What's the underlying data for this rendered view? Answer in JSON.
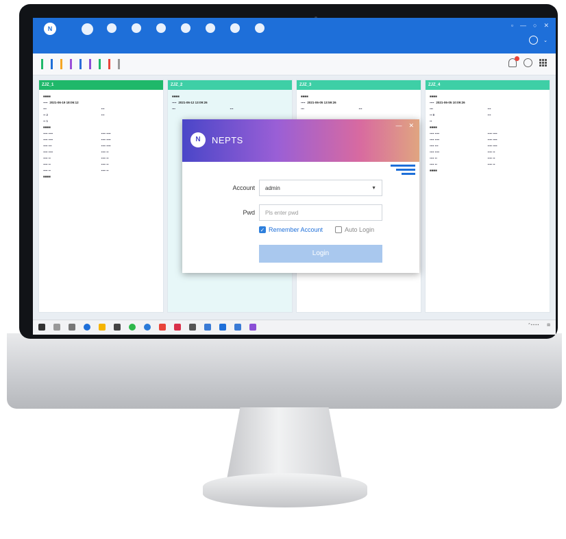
{
  "colors": {
    "header_blue": "#1e6fd9",
    "card_green": "#1fb86a",
    "card_teal": "#3ecfa6",
    "login_button": "#a9c8ee",
    "checkbox_on": "#2e7fdc"
  },
  "app": {
    "logo_mark": "N",
    "logo_text": "",
    "nav": [
      {
        "label": "",
        "icon": "dashboard-icon"
      },
      {
        "label": "",
        "icon": "clock-icon"
      },
      {
        "label": "",
        "icon": "chart-icon"
      },
      {
        "label": "",
        "icon": "monitor-icon"
      },
      {
        "label": "",
        "icon": "list-icon"
      },
      {
        "label": "",
        "icon": "grid-icon"
      },
      {
        "label": "",
        "icon": "user-icon"
      },
      {
        "label": "",
        "icon": "settings-icon"
      }
    ],
    "window_controls": [
      "▫",
      "—",
      "○",
      "✕"
    ],
    "user_name": ""
  },
  "filter_bar": {
    "legend": [
      {
        "label": "",
        "color": "#1fb86a"
      },
      {
        "label": "",
        "color": "#1e6fd9"
      },
      {
        "label": "",
        "color": "#f5a623"
      },
      {
        "label": "",
        "color": "#9b4fd8"
      },
      {
        "label": "",
        "color": "#2b6bd9"
      },
      {
        "label": "",
        "color": "#8a4fd6"
      },
      {
        "label": "",
        "color": "#1fb86a"
      },
      {
        "label": "",
        "color": "#e8443a"
      },
      {
        "label": "",
        "color": "#999999"
      }
    ],
    "right_text": ""
  },
  "cards": [
    {
      "title": "ZJZ_1",
      "head_color": "#1fb86a",
      "badge": "",
      "datetime": "2021-06-19 18:06:12",
      "code": "",
      "val": "2",
      "val2": "",
      "extra": "1",
      "selected": false
    },
    {
      "title": "ZJZ_2",
      "head_color": "#3ecfa6",
      "badge": "",
      "datetime": "2021-06-12 13:09:26",
      "code": "",
      "val": "",
      "val2": "",
      "extra": "",
      "selected": true
    },
    {
      "title": "ZJZ_3",
      "head_color": "#3ecfa6",
      "badge": "",
      "datetime": "2021-06-05 13:59:26",
      "code": "",
      "val": "",
      "val2": "",
      "extra": "",
      "selected": false
    },
    {
      "title": "ZJZ_4",
      "head_color": "#3ecfa6",
      "badge": "",
      "datetime": "2021-06-05 10:09:26",
      "code": "",
      "val": "8",
      "val2": "",
      "extra": "",
      "selected": false
    }
  ],
  "login": {
    "title": "NEPTS",
    "logo_mark": "N",
    "controls": [
      "—",
      "✕"
    ],
    "account_label": "Account",
    "account_value": "admin",
    "pwd_label": "Pwd",
    "pwd_placeholder": "Pls enter pwd",
    "remember_label": "Remember Account",
    "remember_checked": true,
    "auto_login_label": "Auto Login",
    "auto_login_checked": false,
    "login_button": "Login"
  },
  "taskbar": {
    "time": "",
    "date": ""
  }
}
